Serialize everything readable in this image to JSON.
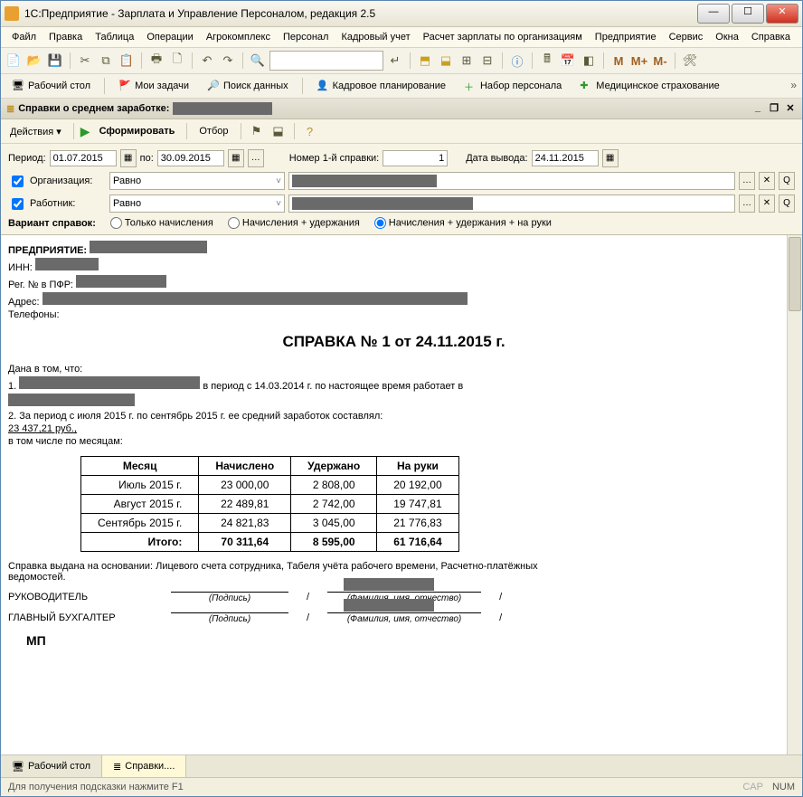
{
  "window": {
    "title": "1С:Предприятие - Зарплата и Управление Персоналом, редакция 2.5"
  },
  "menu": {
    "file": "Файл",
    "edit": "Правка",
    "table": "Таблица",
    "ops": "Операции",
    "agro": "Агрокомплекс",
    "personal": "Персонал",
    "kadr": "Кадровый учет",
    "salary": "Расчет зарплаты по организациям",
    "company": "Предприятие",
    "service": "Сервис",
    "windows": "Окна",
    "help": "Справка"
  },
  "tabs": {
    "desktop": "Рабочий стол",
    "tasks": "Мои задачи",
    "search": "Поиск данных",
    "planning": "Кадровое планирование",
    "recruit": "Набор персонала",
    "med": "Медицинское страхование"
  },
  "panel": {
    "title": "Справки о среднем заработке:",
    "actions": "Действия",
    "form": "Сформировать",
    "filter": "Отбор"
  },
  "filters": {
    "period_lbl": "Период:",
    "from": "01.07.2015",
    "to_lbl": "по:",
    "to": "30.09.2015",
    "number_lbl": "Номер 1-й справки:",
    "number": "1",
    "out_date_lbl": "Дата вывода:",
    "out_date": "24.11.2015",
    "org_lbl": "Организация:",
    "org_op": "Равно",
    "emp_lbl": "Работник:",
    "emp_op": "Равно",
    "variant_lbl": "Вариант справок:",
    "opt1": "Только начисления",
    "opt2": "Начисления + удержания",
    "opt3": "Начисления + удержания + на руки"
  },
  "doc": {
    "company_lbl": "ПРЕДПРИЯТИЕ:",
    "inn_lbl": "ИНН:",
    "pfr_lbl": "Рег. № в ПФР:",
    "addr_lbl": "Адрес:",
    "phone_lbl": "Телефоны:",
    "title": "СПРАВКА № 1 от 24.11.2015 г.",
    "given": "Дана в том, что:",
    "p1a": "1.",
    "p1b": "в период с 14.03.2014 г. по настоящее время работает в",
    "p2": "2. За период с июля 2015  г. по сентябрь 2015  г.  ее средний заработок составлял:",
    "amount": "23 437,21 руб.,",
    "bymonth": "в том числе по месяцам:",
    "th_month": "Месяц",
    "th_acc": "Начислено",
    "th_ded": "Удержано",
    "th_net": "На руки",
    "rows": [
      {
        "m": "Июль 2015 г.",
        "a": "23 000,00",
        "d": "2 808,00",
        "n": "20 192,00"
      },
      {
        "m": "Август 2015 г.",
        "a": "22 489,81",
        "d": "2 742,00",
        "n": "19 747,81"
      },
      {
        "m": "Сентябрь 2015 г.",
        "a": "24 821,83",
        "d": "3 045,00",
        "n": "21 776,83"
      }
    ],
    "total_lbl": "Итого:",
    "total_a": "70 311,64",
    "total_d": "8 595,00",
    "total_n": "61 716,64",
    "basis": "Справка выдана на основании: Лицевого счета сотрудника, Табеля учёта рабочего времени, Расчетно-платёжных ведомостей.",
    "head": "РУКОВОДИТЕЛЬ",
    "acct": "ГЛАВНЫЙ БУХГАЛТЕР",
    "sign": "(Подпись)",
    "fio": "(Фамилия, имя, отчество)",
    "stamp": "МП"
  },
  "bottom": {
    "desktop": "Рабочий стол",
    "doc": "Справки...."
  },
  "status": {
    "hint": "Для получения подсказки нажмите F1",
    "cap": "CAP",
    "num": "NUM"
  }
}
